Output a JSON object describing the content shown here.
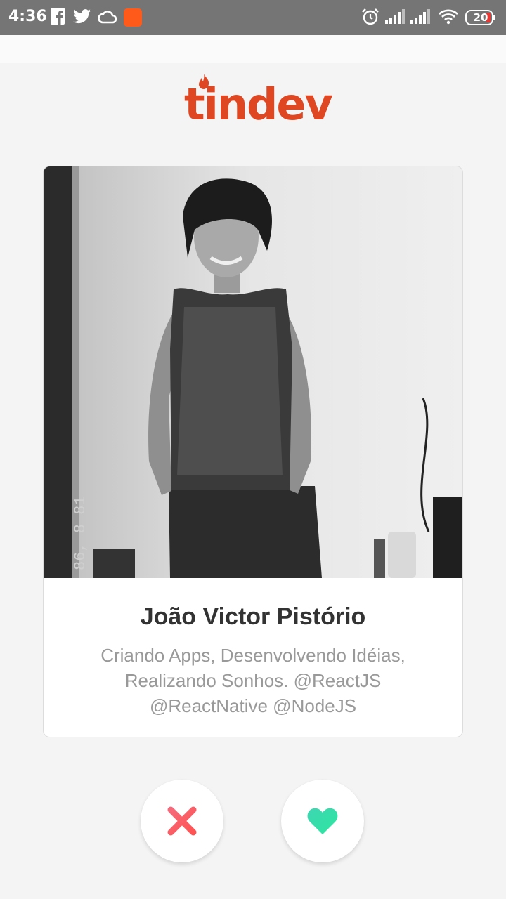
{
  "status_bar": {
    "time": "4:36",
    "battery": "20",
    "icons": [
      "facebook-icon",
      "twitter-icon",
      "cloud-icon",
      "app-notification-icon",
      "alarm-icon",
      "signal-icon",
      "signal-icon",
      "wifi-icon",
      "battery-icon"
    ]
  },
  "app": {
    "logo_text": "tindev",
    "brand_color": "#df4723"
  },
  "card": {
    "name": "João Victor Pistório",
    "bio": "Criando Apps, Desenvolvendo Idéias, Realizando Sonhos. @ReactJS @ReactNative @NodeJS",
    "photo_caption": "86, 8 81"
  },
  "actions": {
    "dislike_icon": "close-icon",
    "like_icon": "heart-icon",
    "dislike_colors": [
      "#f56a7a",
      "#ff5252"
    ],
    "like_colors": [
      "#3ed6b2",
      "#2de6a0"
    ]
  }
}
